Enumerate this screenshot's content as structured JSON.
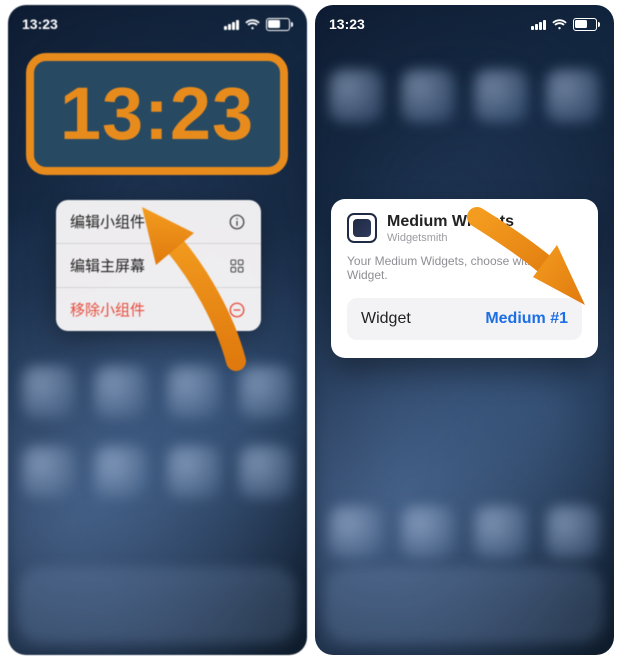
{
  "colors": {
    "accent_orange": "#e88b1d",
    "widget_bg": "#274a62",
    "ios_blue": "#1d6fe5",
    "destructive": "#e74c3c"
  },
  "left": {
    "status_time": "13:23",
    "clock_time": "13:23",
    "menu": {
      "edit_widget": "编辑小组件",
      "edit_home": "编辑主屏幕",
      "remove": "移除小组件"
    }
  },
  "right": {
    "status_time": "13:23",
    "card": {
      "title": "Medium Widgets",
      "subtitle": "Widgetsmith",
      "description": "Your Medium Widgets, choose with this Widget.",
      "row_key": "Widget",
      "row_value": "Medium #1"
    }
  }
}
